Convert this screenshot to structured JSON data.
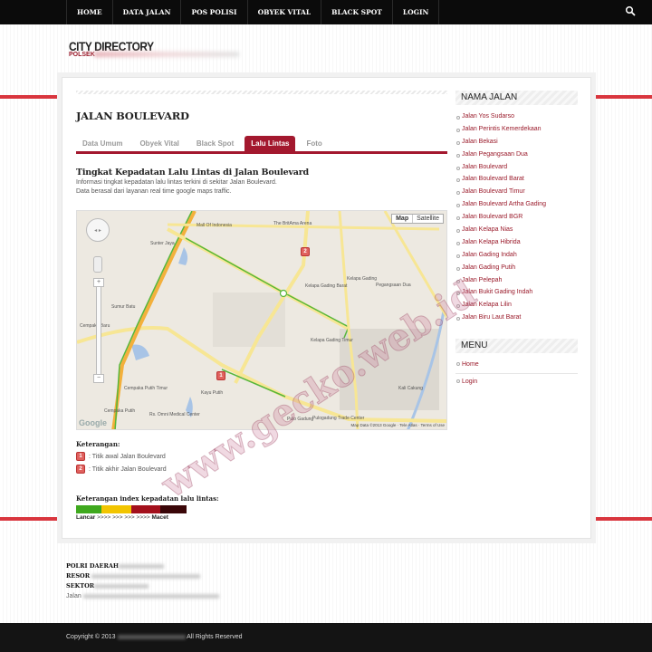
{
  "nav": {
    "items": [
      "HOME",
      "DATA JALAN",
      "POS POLISI",
      "OBYEK VITAL",
      "BLACK SPOT",
      "LOGIN"
    ],
    "search_icon": "search-icon"
  },
  "logo": {
    "title": "CITY DIRECTORY",
    "subtitle": "POLSEK"
  },
  "main": {
    "title": "JALAN BOULEVARD",
    "tabs": [
      "Data Umum",
      "Obyek Vital",
      "Black Spot",
      "Lalu Lintas",
      "Foto"
    ],
    "active_tab": "Lalu Lintas",
    "section_title": "Tingkat Kepadatan Lalu Lintas di Jalan Boulevard",
    "desc1": "Informasi tingkat kepadatan lalu lintas terkini di sekitar Jalan Boulevard.",
    "desc2": "Data berasal dari layanan real time google maps traffic.",
    "map": {
      "btn_map": "Map",
      "btn_satellite": "Satellite",
      "google": "Google",
      "copyright": "Map Data ©2013 Google · Tele Atlas · Terms of Use",
      "labels": [
        "Mall Of Indonesia",
        "Sunter Jaya",
        "The BritAma Arena",
        "Kelapa Gading Barat",
        "Kelapa Gading",
        "Pegangsaan Dua",
        "Sumur Batu",
        "Cempaka Baru",
        "Kelapa Gading Timur",
        "Kayu Putih",
        "Cempaka Putih Timur",
        "Cempaka Putih",
        "Rs. Omni Medical Center",
        "Pulo Gadung",
        "Pulogadung Trade Center",
        "Kali Cakung"
      ],
      "pin1": "1",
      "pin2": "2"
    },
    "legend": {
      "title": "Keterangan:",
      "items": [
        {
          "pin": "1",
          "text": ": Titik awal Jalan Boulevard"
        },
        {
          "pin": "2",
          "text": ": Titik akhir Jalan Boulevard"
        }
      ]
    },
    "index": {
      "title": "Keterangan index kepadatan lalu lintas:",
      "low": "Lancar",
      "arrows": ">>>> >>> >>> >>>>",
      "high": "Macet",
      "colors": [
        "#3fa91e",
        "#f2c500",
        "#a3101c",
        "#3a0608"
      ]
    }
  },
  "sidebar": {
    "nama_jalan_title": "NAMA JALAN",
    "streets": [
      "Jalan Yos Sudarso",
      "Jalan Perintis Kemerdekaan",
      "Jalan Bekasi",
      "Jalan Pegangsaan Dua",
      "Jalan Boulevard",
      "Jalan Boulevard Barat",
      "Jalan Boulevard Timur",
      "Jalan Boulevard Artha Gading",
      "Jalan Boulevard BGR",
      "Jalan Kelapa Nias",
      "Jalan Kelapa Hibrida",
      "Jalan Gading Indah",
      "Jalan Gading Putih",
      "Jalan Pelepah",
      "Jalan Bukit Gading Indah",
      "Jalan Kelapa Lilin",
      "Jalan Biru Laut Barat"
    ],
    "menu_title": "MENU",
    "menu": [
      "Home",
      "Login"
    ]
  },
  "address": {
    "l1": "POLRI DAERAH",
    "l2": "RESOR",
    "l3": "SEKTOR",
    "l4": "Jalan"
  },
  "footer": {
    "copyright": "Copyright © 2013",
    "rights": "All Rights Reserved"
  },
  "watermark": "www.gecko.web.id"
}
